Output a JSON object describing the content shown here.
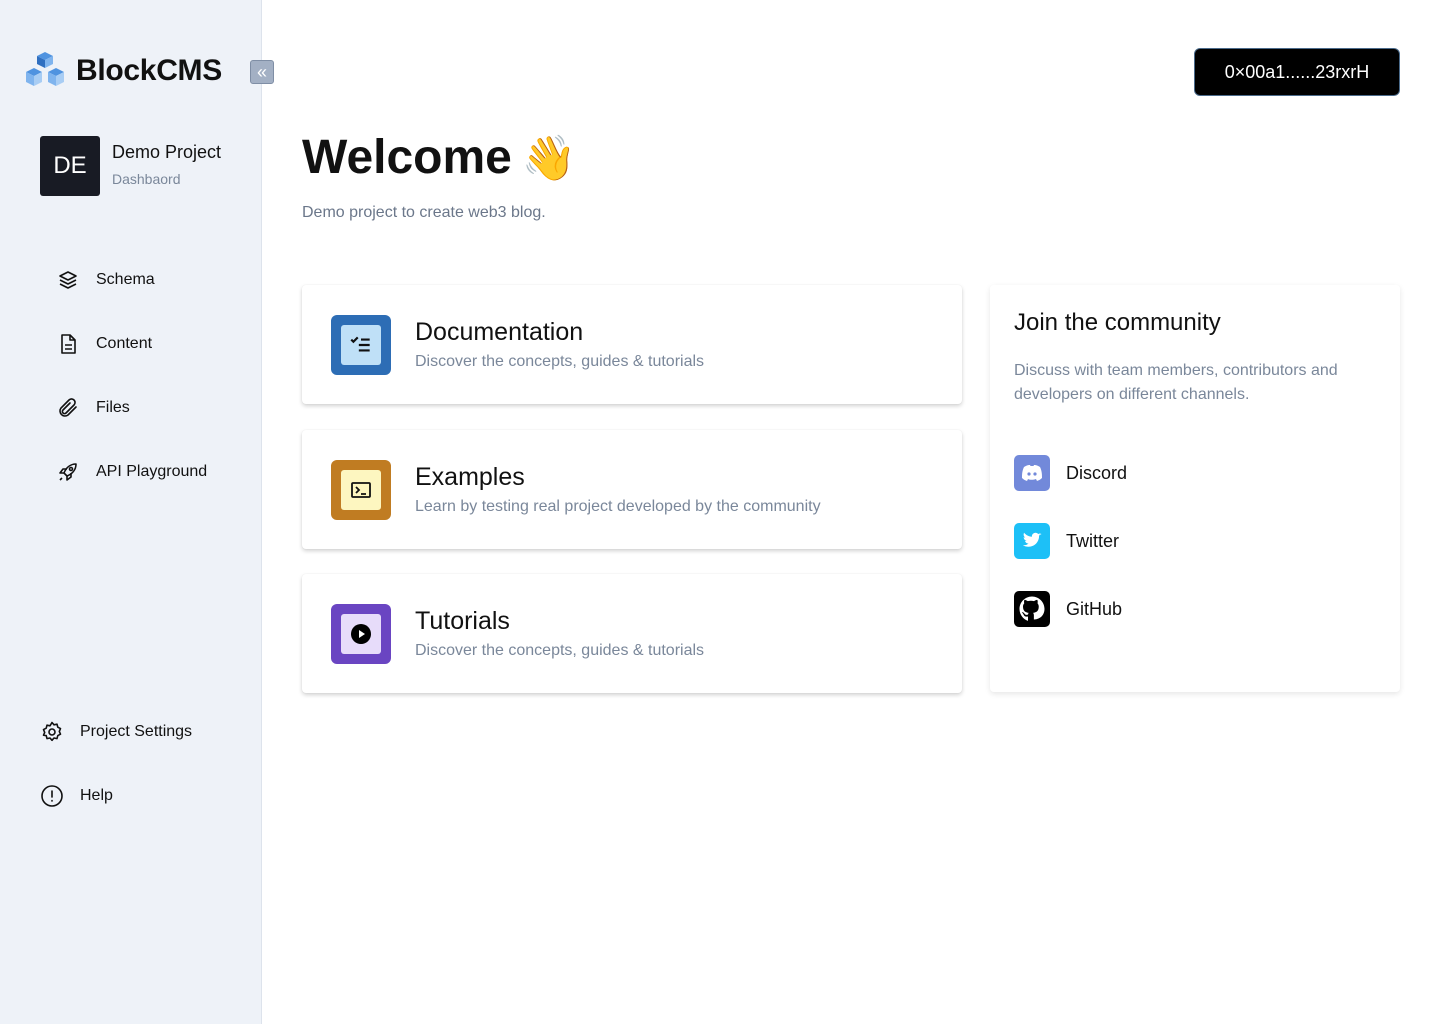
{
  "sidebar": {
    "brand": "BlockCMS",
    "collapse_icon": "chevrons-left-icon",
    "project": {
      "initials": "DE",
      "name": "Demo Project",
      "subtitle": "Dashbaord"
    },
    "items": [
      {
        "label": "Schema",
        "icon": "layers-icon"
      },
      {
        "label": "Content",
        "icon": "document-icon"
      },
      {
        "label": "Files",
        "icon": "paperclip-icon"
      },
      {
        "label": "API Playground",
        "icon": "rocket-icon"
      }
    ],
    "bottom_items": [
      {
        "label": "Project Settings",
        "icon": "gear-icon"
      },
      {
        "label": "Help",
        "icon": "info-circle-icon"
      }
    ]
  },
  "header": {
    "wallet": "0×00a1......23rxrH"
  },
  "main": {
    "title": "Welcome",
    "emoji": "👋",
    "subtitle": "Demo project to create web3 blog.",
    "cards": [
      {
        "title": "Documentation",
        "desc": "Discover the concepts, guides & tutorials",
        "icon": "checklist-icon",
        "color": "#2d6db5",
        "inner": "#bfe0f7"
      },
      {
        "title": "Examples",
        "desc": "Learn by testing real project developed by the community",
        "icon": "terminal-icon",
        "color": "#c07c22",
        "inner": "#fdf6c0"
      },
      {
        "title": "Tutorials",
        "desc": "Discover the concepts, guides & tutorials",
        "icon": "play-circle-icon",
        "color": "#6a45c2",
        "inner": "#e7dcfa"
      }
    ]
  },
  "community": {
    "title": "Join the community",
    "desc": "Discuss with team members, contributors and developers on different channels.",
    "links": [
      {
        "label": "Discord",
        "icon": "discord-icon",
        "color": "#7289da"
      },
      {
        "label": "Twitter",
        "icon": "twitter-icon",
        "color": "#1dc0f7"
      },
      {
        "label": "GitHub",
        "icon": "github-icon",
        "color": "#000000"
      }
    ]
  }
}
